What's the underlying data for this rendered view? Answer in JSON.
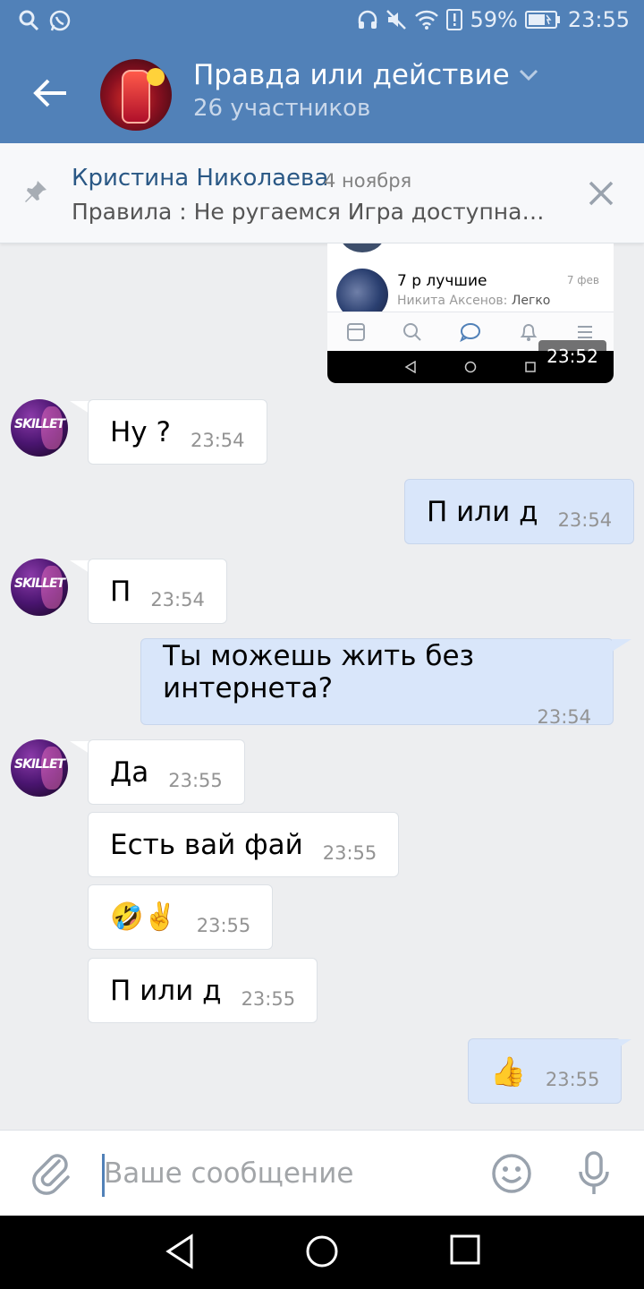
{
  "status_bar": {
    "battery": "59%",
    "time": "23:55",
    "icons": [
      "search-icon",
      "whatsapp-icon",
      "headphones-icon",
      "mute-icon",
      "wifi-icon",
      "sim-alert-icon",
      "battery-icon"
    ]
  },
  "header": {
    "title": "Правда или действие",
    "subtitle": "26 участников"
  },
  "pinned": {
    "author": "Кристина Николаева",
    "date": "4 ноября",
    "text": "Правила :  Не ругаемся  Игра доступна…"
  },
  "screenshot": {
    "chat_name": "7 р лучшие",
    "chat_date": "7 фев",
    "preview_author": "Никита Аксенов:",
    "preview_text": "Легко",
    "time": "23:52"
  },
  "messages": [
    {
      "dir": "in",
      "text": "Ну ?",
      "time": "23:54"
    },
    {
      "dir": "out",
      "text": "П или д",
      "time": "23:54"
    },
    {
      "dir": "in",
      "text": "П",
      "time": "23:54"
    },
    {
      "dir": "out",
      "text": "Ты можешь жить без интернета?",
      "time": "23:54"
    },
    {
      "dir": "in",
      "text": "Да",
      "time": "23:55"
    },
    {
      "dir": "in",
      "text": "Есть вай фай",
      "time": "23:55"
    },
    {
      "dir": "in",
      "text": "🤣✌️",
      "time": "23:55"
    },
    {
      "dir": "in",
      "text": "П или д",
      "time": "23:55"
    },
    {
      "dir": "out",
      "text": "👍",
      "time": "23:55"
    }
  ],
  "composer": {
    "placeholder": "Ваше сообщение"
  },
  "colors": {
    "header": "#5181b8",
    "background": "#edeef0",
    "outgoing": "#d9e6fa",
    "incoming": "#ffffff",
    "link": "#2a5885"
  }
}
